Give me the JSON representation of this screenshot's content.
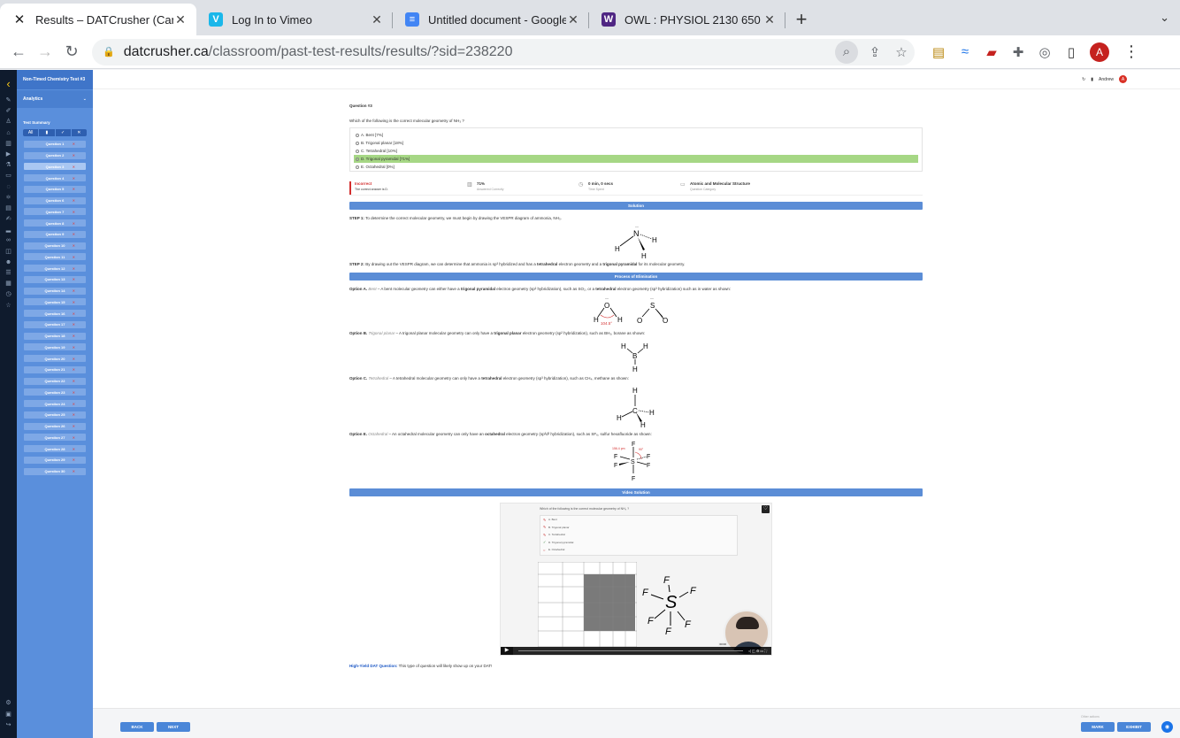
{
  "browser": {
    "tabs": [
      {
        "title": "Results – DATCrusher (Canadia",
        "icon_color": "#1f1f1f",
        "icon_glyph": "✕",
        "active": true
      },
      {
        "title": "Log In to Vimeo",
        "icon_color": "#1ab7ea",
        "icon_glyph": "V",
        "active": false
      },
      {
        "title": "Untitled document - Google Do",
        "icon_color": "#4285f4",
        "icon_glyph": "≡",
        "active": false
      },
      {
        "title": "OWL : PHYSIOL 2130 650 SU2",
        "icon_color": "#4f2683",
        "icon_glyph": "W",
        "active": false
      }
    ],
    "url_host": "datcrusher.ca",
    "url_path": "/classroom/past-test-results/results/?sid=238220",
    "profile_initial": "A"
  },
  "sidebar": {
    "test_title": "Non-Timed Chemistry Test #3",
    "analytics_label": "Analytics",
    "summary_label": "Test Summary",
    "filters": [
      "All",
      "▮",
      "✓",
      "✕"
    ],
    "questions": [
      "Question 1",
      "Question 2",
      "Question 3",
      "Question 4",
      "Question 5",
      "Question 6",
      "Question 7",
      "Question 8",
      "Question 9",
      "Question 10",
      "Question 11",
      "Question 12",
      "Question 13",
      "Question 14",
      "Question 15",
      "Question 16",
      "Question 17",
      "Question 18",
      "Question 19",
      "Question 20",
      "Question 21",
      "Question 22",
      "Question 23",
      "Question 24",
      "Question 25",
      "Question 26",
      "Question 27",
      "Question 28",
      "Question 29",
      "Question 30"
    ],
    "current_index": 2
  },
  "user": {
    "name": "Andrew",
    "initial": "A"
  },
  "question": {
    "heading": "Question #3",
    "text": "Which of the following is the correct molecular geometry of NH₃ ?",
    "answers": [
      {
        "label": "A. Bent [7%]",
        "correct": false
      },
      {
        "label": "B. Trigonal planar [18%]",
        "correct": false
      },
      {
        "label": "C. Tetrahedral [10%]",
        "correct": false
      },
      {
        "label": "D. Trigonal pyramidal [71%]",
        "correct": true
      },
      {
        "label": "E. Octahedral [0%]",
        "correct": false
      }
    ]
  },
  "stats": {
    "result": "Incorrect",
    "result_sub": "The correct answer is D.",
    "percent": "71%",
    "percent_sub": "Answered Correctly",
    "time": "0 min, 0 secs",
    "time_sub": "Time Spent",
    "category": "Atomic and Molecular Structure",
    "category_sub": "Question Category"
  },
  "solution": {
    "header": "Solution",
    "step1_label": "STEP 1:",
    "step1": " To determine the correct molecular geometry, we must begin by drawing the VESPR diagram of ammonia, NH₃.",
    "step2_label": "STEP 2:",
    "step2_a": " By drawing out the VESPR diagram, we can determine that ammonia is sp³ hybridized and has a ",
    "step2_b": "tetrahedral",
    "step2_c": " electron geometry and a ",
    "step2_d": "trigonal pyramidal",
    "step2_e": " for its molecular geometry."
  },
  "poe": {
    "header": "Process of Elimination",
    "a_label": "Option A.",
    "a_name": "Bent",
    "a_1": " – A bent molecular geometry can either have a ",
    "a_2": "trigonal pyramidal",
    "a_3": " electron geometry (sp² hybridization), such as SO₂, or a ",
    "a_4": "tetrahedral",
    "a_5": " electron geometry (sp³ hybridization) such as in water as shown:",
    "b_label": "Option B.",
    "b_name": "Trigonal planar",
    "b_1": " – A trigonal planar molecular geometry can only have a ",
    "b_2": "trigonal planar",
    "b_3": " electron geometry (sp² hybridization), such as BH₃, borane as shown:",
    "c_label": "Option C.",
    "c_name": "Tetrahedral",
    "c_1": " – A tetrahedral molecular geometry can only have a ",
    "c_2": "tetrahedral",
    "c_3": " electron geometry (sp³ hybridization), such as CH₄, methane as shown:",
    "e_label": "Option E.",
    "e_name": "Octahedral",
    "e_1": " – An octahedral molecular geometry can only have an ",
    "e_2": "octahedral",
    "e_3": " electron geometry (sp³d² hybridization), such as SF₆, sulfur hexafluoride as shown:"
  },
  "molecules": {
    "nh3_n": "N",
    "h": "H",
    "o": "O",
    "s": "S",
    "b": "B",
    "c": "C",
    "f": "F",
    "water_angle": "104.5°",
    "sf6_bond": "156.4 pm",
    "sf6_angle": "90°"
  },
  "video": {
    "header": "Video Solution",
    "question": "Which of the following is the correct molecular geometry of NH₃ ?",
    "options": [
      "A. Bent",
      "B. Trigonal planar",
      "C. Tetrahedral",
      "D. Trigonal pyramidal",
      "E. Octahedral"
    ],
    "time": "00:00"
  },
  "high_yield": {
    "label": "High-Yield DAT Question:",
    "text": " This type of question will likely show up on your DAT!"
  },
  "footer": {
    "back": "BACK",
    "next": "NEXT",
    "other_actions": "Other actions",
    "mark": "MARK",
    "exhibit": "EXHIBIT"
  }
}
